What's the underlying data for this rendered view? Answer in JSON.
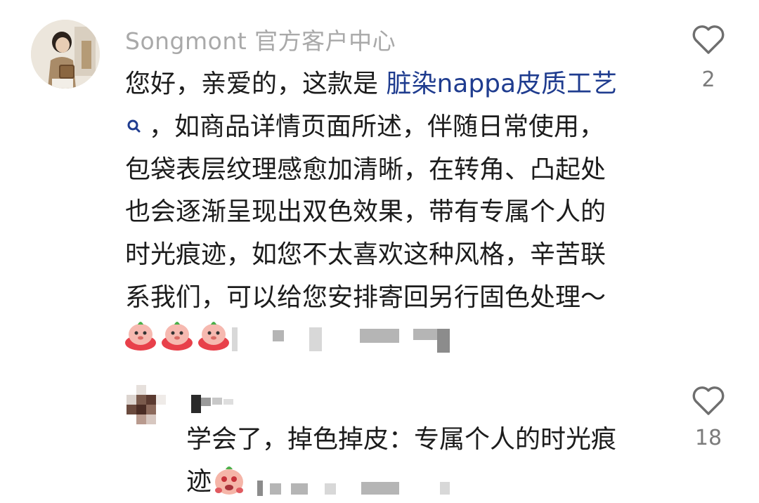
{
  "main_comment": {
    "username": "Songmont 官方客户中心",
    "lines": {
      "l1_prefix": "您好，亲爱的，这款是 ",
      "l1_link": "脏染nappa皮质工艺",
      "l2_rest": "，如商品详情页面所述，伴随日常使用，",
      "l3": "包袋表层纹理感愈加清晰，在转角、凸起处",
      "l4": "也会逐渐呈现出双色效果，带有专属个人的",
      "l5": "时光痕迹，如您不太喜欢这种风格，辛苦联",
      "l6": "系我们，可以给您安排寄回另行固色处理～"
    },
    "like_count": "2"
  },
  "reply_comment": {
    "lines": {
      "l1": "学会了，掉色掉皮：专属个人的时光痕",
      "l2": "迹"
    },
    "like_count": "18"
  },
  "colors": {
    "link": "#1f3c8f",
    "username": "#a9a9a9",
    "count": "#7c7c7c"
  },
  "icons": [
    "heart-icon",
    "search-icon",
    "emoji-icon",
    "avatar"
  ]
}
